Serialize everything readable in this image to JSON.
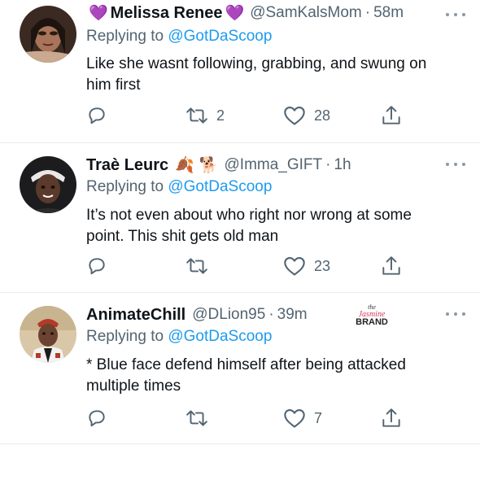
{
  "tweets": [
    {
      "name": "Melissa Renee",
      "name_emoji_left": "💜",
      "name_emoji_right": "💜",
      "handle": "@SamKalsMom",
      "time": "58m",
      "reply_prefix": "Replying to",
      "reply_to": "@GotDaScoop",
      "text_line1": "Like she wasnt following, grabbing, and swung on",
      "text_line2": "him first",
      "retweets": "2",
      "likes": "28"
    },
    {
      "name": "Traè Leurc",
      "name_emoji_1": "🍂",
      "name_emoji_2": "🐕",
      "handle": "@Imma_GIFT",
      "time": "1h",
      "reply_prefix": "Replying to",
      "reply_to": "@GotDaScoop",
      "text_line1": "It’s not even about who right nor wrong at some",
      "text_line2": "point. This shit gets old man",
      "retweets": "",
      "likes": "23"
    },
    {
      "name": "AnimateChill",
      "handle": "@DLion95",
      "time": "39m",
      "reply_prefix": "Replying to",
      "reply_to": "@GotDaScoop",
      "text_line1": "* Blue face defend himself after being attacked",
      "text_line2": "multiple times",
      "retweets": "",
      "likes": "7"
    }
  ],
  "watermark": {
    "line1": "the",
    "line2": "Jasmine",
    "line3": "BRAND"
  },
  "icons": {
    "reply": "reply-icon",
    "retweet": "retweet-icon",
    "like": "heart-icon",
    "share": "share-icon",
    "more": "more-icon"
  },
  "colors": {
    "text": "#0f1419",
    "secondary": "#536471",
    "link": "#1d9bf0",
    "divider": "#e6ecf0"
  }
}
